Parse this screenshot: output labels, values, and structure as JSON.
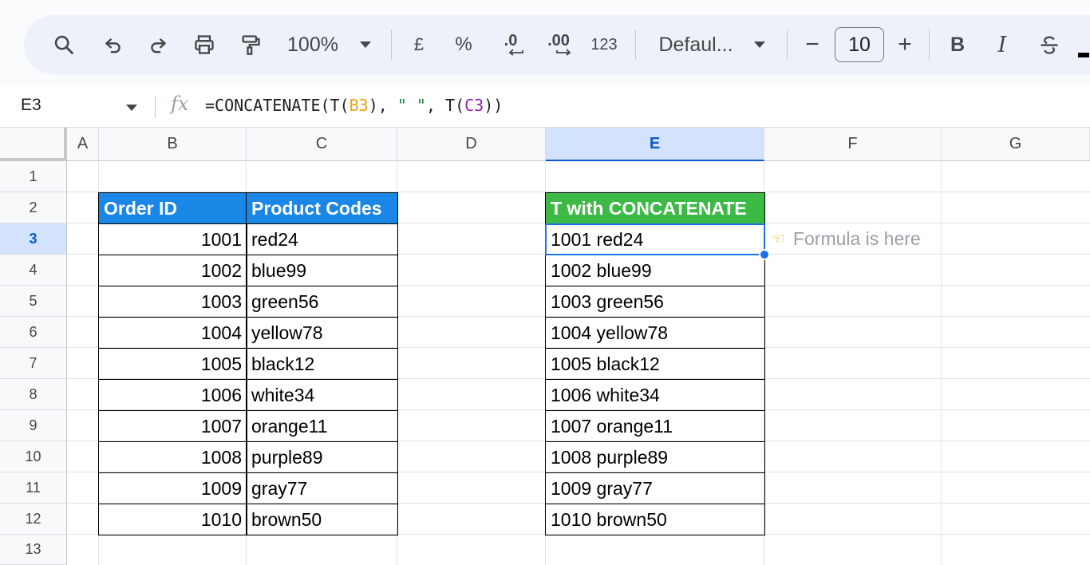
{
  "toolbar": {
    "zoom": "100%",
    "currency": "£",
    "percent": "%",
    "decrease_decimal": ".0",
    "increase_decimal": ".00",
    "number_format": "123",
    "font": "Defaul...",
    "font_size": "10",
    "minus": "−",
    "plus": "+",
    "bold": "B",
    "italic": "I"
  },
  "formula_bar": {
    "cell_ref": "E3",
    "fx": "fx",
    "formula_parts": [
      "=CONCATENATE(T(",
      "B3",
      "), ",
      "\" \"",
      ", T(",
      "C3",
      "))"
    ]
  },
  "columns": [
    "A",
    "B",
    "C",
    "D",
    "E",
    "F",
    "G"
  ],
  "rows": [
    "1",
    "2",
    "3",
    "4",
    "5",
    "6",
    "7",
    "8",
    "9",
    "10",
    "11",
    "12",
    "13"
  ],
  "table": {
    "header_id": "Order ID",
    "header_codes": "Product Codes",
    "header_result": "T with CONCATENATE",
    "order_ids": [
      "1001",
      "1002",
      "1003",
      "1004",
      "1005",
      "1006",
      "1007",
      "1008",
      "1009",
      "1010"
    ],
    "codes": [
      "red24",
      "blue99",
      "green56",
      "yellow78",
      "black12",
      "white34",
      "orange11",
      "purple89",
      "gray77",
      "brown50"
    ],
    "results": [
      "1001 red24",
      "1002 blue99",
      "1003 green56",
      "1004 yellow78",
      "1005 black12",
      "1006 white34",
      "1007 orange11",
      "1008 purple89",
      "1009 gray77",
      "1010 brown50"
    ]
  },
  "note": "Formula is here",
  "colors": {
    "header_blue": "#1a86e5",
    "header_green": "#3cba45",
    "selection": "#1a73e8"
  }
}
